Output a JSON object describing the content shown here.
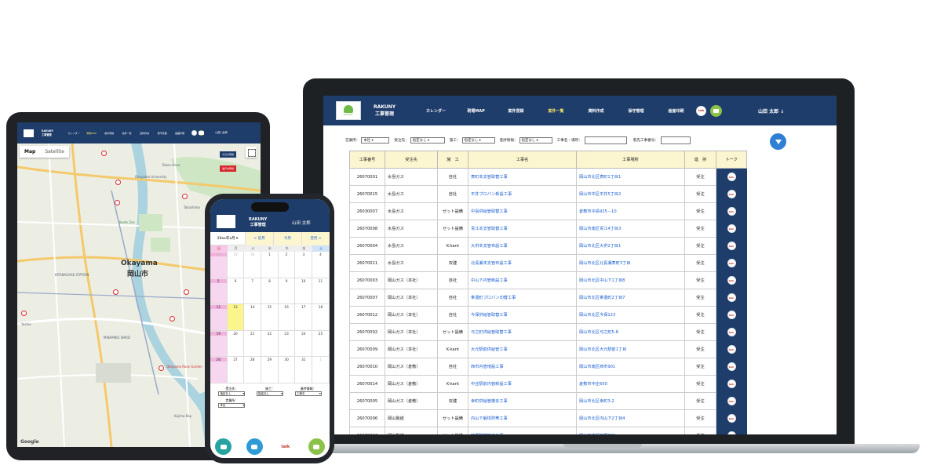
{
  "laptop": {
    "brand": [
      "RAKUNY",
      "工事管理"
    ],
    "nav": [
      "カレンダー",
      "現場MAP",
      "案件登録",
      "案件一覧",
      "資料作成",
      "保守管理",
      "画面印刷"
    ],
    "nav_active": "案件一覧",
    "user": "山田 太郎 ↓",
    "filters": {
      "office_label": "営業所：",
      "office_value": "本社",
      "client_label": "受注先：",
      "client_value": "指定なし",
      "builder_label": "施工：",
      "builder_value": "指定なし",
      "progress_label": "進捗情報：",
      "progress_value": "指定なし",
      "name_label": "工事名・場所：",
      "number_label": "客先工事番号："
    },
    "table_headers": [
      "工事番号",
      "受注先",
      "施　工",
      "工事名",
      "工事場所",
      "進　捗",
      "トーク"
    ],
    "rows": [
      [
        "26070001",
        "水島ガス",
        "自社",
        "表町本支管取替工事",
        "岡山市北区表町1丁目1",
        "受注"
      ],
      [
        "26070015",
        "水島ガス",
        "自社",
        "平井プロパン新設工事",
        "岡山市中区平井5丁目2",
        "受注"
      ],
      [
        "26030007",
        "水島ガス",
        "ゼット設備",
        "中島供給管取替工事",
        "倉敷市中島925－10",
        "受注"
      ],
      [
        "26070008",
        "水島ガス",
        "ゼット設備",
        "青江本支管取替工事",
        "岡山市南区青江4丁目3",
        "受注"
      ],
      [
        "26070004",
        "水島ガス",
        "K-kant",
        "大供本支管布設工事",
        "岡山市北区大供2丁目1",
        "受注"
      ],
      [
        "26070011",
        "水島ガス",
        "双建",
        "北長瀬本支管布設工事",
        "岡山市北区北長瀬表町3丁目",
        "受注"
      ],
      [
        "26070003",
        "岡山ガス（本社）",
        "自社",
        "中山下内管新設工事",
        "岡山市北区中山下1丁目8",
        "受注"
      ],
      [
        "26070007",
        "岡山ガス（本社）",
        "自社",
        "奉還町プロパン切替工事",
        "岡山市北区奉還町2丁目7",
        "受注"
      ],
      [
        "26070012",
        "岡山ガス（本社）",
        "自社",
        "今保供給管取替工事",
        "岡山市北区今保123",
        "受注"
      ],
      [
        "26070002",
        "岡山ガス（本社）",
        "ゼット設備",
        "弓之町供給管取替工事",
        "岡山市北区弓之町5-8",
        "受注"
      ],
      [
        "26070009",
        "岡山ガス（本社）",
        "K-kant",
        "大元駅前供給管工事",
        "岡山市北区大元駅前1丁目",
        "受注"
      ],
      [
        "26070010",
        "岡山ガス（倉敷）",
        "自社",
        "西市内管増設工事",
        "岡山市南区西市901",
        "受注"
      ],
      [
        "26070014",
        "岡山ガス（倉敷）",
        "K-kant",
        "中庄駅前内管新設工事",
        "倉敷市中庄650",
        "受注"
      ],
      [
        "26070005",
        "岡山ガス（倉敷）",
        "双建",
        "幸町供給管撤去工事",
        "岡山市北区幸町3-2",
        "受注"
      ],
      [
        "26070006",
        "岡山製紙",
        "ゼット設備",
        "内山下解体附帯工事",
        "岡山市北区内山下2丁目4",
        "受注"
      ],
      [
        "26070013",
        "岡山製紙",
        "ゼット設備",
        "妹尾附帯撤去工事",
        "岡山市南区妹尾880",
        "受注"
      ]
    ],
    "talk_icon_text": "talk"
  },
  "tablet": {
    "brand": [
      "RAKUNY",
      "工事管理"
    ],
    "nav": [
      "カレンダー",
      "現場MAP",
      "案件登録",
      "案件一覧",
      "資料作成",
      "保守管理",
      "画面印刷"
    ],
    "nav_active": "現場MAP",
    "user": "山田 太郎",
    "map_tabs": [
      "Map",
      "Satellite"
    ],
    "legend": [
      "今日の現場",
      "進行中現場"
    ],
    "labels": {
      "okayama_en": "Okayama",
      "okayama_jp": "岡山市",
      "kitanagase": "KITANAGASE STATION",
      "ikeda_zoo": "Ikeda Zoo",
      "okayama_univ": "Okayama University",
      "minamiku": "MINAMIKU WARD",
      "bizen_hara": "Bizen-Hara",
      "takashima": "Takashima",
      "kojima": "Kojima Bay",
      "rose": "Okayama Rose Garden",
      "yoshie": "Yoshie",
      "google": "Google",
      "attribution": "Keyboard shortcuts  Map data"
    }
  },
  "phone": {
    "brand": [
      "RAKUNY",
      "工事管理"
    ],
    "user": "山田 太郎",
    "month": "20xx年x月",
    "prev": "< 前月",
    "today": "今月",
    "next": "翌月 >",
    "dow": [
      "日",
      "月",
      "火",
      "水",
      "木",
      "金",
      "土"
    ],
    "weeks": [
      [
        "28",
        "29",
        "30",
        "1",
        "2",
        "3",
        "4"
      ],
      [
        "5",
        "6",
        "7",
        "8",
        "9",
        "10",
        "11"
      ],
      [
        "12",
        "13",
        "14",
        "15",
        "16",
        "17",
        "18"
      ],
      [
        "19",
        "20",
        "21",
        "22",
        "23",
        "24",
        "25"
      ],
      [
        "26",
        "27",
        "28",
        "29",
        "30",
        "31",
        "1"
      ]
    ],
    "today_date": "13",
    "filters": [
      {
        "label": "受注先：",
        "value": "指定なし"
      },
      {
        "label": "施工：",
        "value": "指定なし"
      },
      {
        "label": "進捗情報：",
        "value": "工事中"
      },
      {
        "label": "営業所：",
        "value": "本社"
      }
    ],
    "bottom_icons": [
      "map-pin-icon",
      "user-icon",
      "talk-icon",
      "chat-icon"
    ],
    "talk_text": "talk"
  }
}
